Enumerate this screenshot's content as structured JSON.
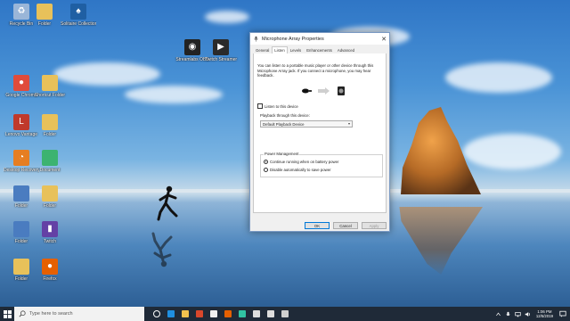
{
  "desktop": {
    "icons": [
      {
        "label": "Recycle Bin",
        "color": "#9ab6d8",
        "glyph": "♻"
      },
      {
        "label": "Folder",
        "color": "#e8c15a",
        "glyph": ""
      },
      {
        "label": "Solitaire Collection",
        "color": "#1f5fa3",
        "glyph": "♠"
      },
      {
        "label": "Streamlabs OBS",
        "color": "#222222",
        "glyph": "◉"
      },
      {
        "label": "Twitch Streamer",
        "color": "#2a2a2a",
        "glyph": "▶"
      },
      {
        "label": "Google Chrome",
        "color": "#e04b3b",
        "glyph": "●"
      },
      {
        "label": "Shortcut Folder",
        "color": "#e8c15a",
        "glyph": ""
      },
      {
        "label": "Lenovo Vantage",
        "color": "#c0392b",
        "glyph": "L"
      },
      {
        "label": "Folder",
        "color": "#e8c15a",
        "glyph": ""
      },
      {
        "label": "Desktop Recovery",
        "color": "#e67e22",
        "glyph": "◔"
      },
      {
        "label": "Document",
        "color": "#3cb371",
        "glyph": ""
      },
      {
        "label": "Folder",
        "color": "#4a7cc0",
        "glyph": ""
      },
      {
        "label": "Folder",
        "color": "#e8c15a",
        "glyph": ""
      },
      {
        "label": "Folder",
        "color": "#4a7cc0",
        "glyph": ""
      },
      {
        "label": "Twitch",
        "color": "#6441a5",
        "glyph": "▮"
      },
      {
        "label": "Folder",
        "color": "#e8c15a",
        "glyph": ""
      },
      {
        "label": "Firefox",
        "color": "#e66000",
        "glyph": "●"
      },
      {
        "label": "OBS Studio",
        "color": "#303030",
        "glyph": "◉"
      },
      {
        "label": "Streamlabs",
        "color": "#31c3a2",
        "glyph": "▣"
      }
    ]
  },
  "dialog": {
    "title": "Microphone Array Properties",
    "close_glyph": "✕",
    "tabs": [
      "General",
      "Listen",
      "Levels",
      "Enhancements",
      "Advanced"
    ],
    "active_tab": "Listen",
    "description": "You can listen to a portable music player or other device through this Microphone Array jack.  If you connect a microphone, you may hear feedback.",
    "listen_label": "Listen to this device",
    "listen_checked": false,
    "playback_label": "Playback through this device:",
    "playback_value": "Default Playback Device",
    "power_title": "Power Management",
    "power_options": [
      "Continue running when on battery power",
      "Disable automatically to save power"
    ],
    "power_selected": 0,
    "buttons": {
      "ok": "OK",
      "cancel": "Cancel",
      "apply": "Apply"
    }
  },
  "taskbar": {
    "search_placeholder": "Type here to search",
    "pinned": [
      {
        "name": "task-view",
        "color": "#ffffff"
      },
      {
        "name": "edge",
        "color": "#1f8fe0"
      },
      {
        "name": "file-explorer",
        "color": "#f2c14e"
      },
      {
        "name": "office",
        "color": "#d9472b"
      },
      {
        "name": "store",
        "color": "#f0f0f0"
      },
      {
        "name": "firefox",
        "color": "#e66000"
      },
      {
        "name": "streamlabs",
        "color": "#31c3a2"
      },
      {
        "name": "clock-app",
        "color": "#dddddd"
      },
      {
        "name": "settings",
        "color": "#dddddd"
      },
      {
        "name": "device",
        "color": "#cfcfcf"
      }
    ],
    "time": "1:06 PM",
    "date": "12/5/2019"
  }
}
